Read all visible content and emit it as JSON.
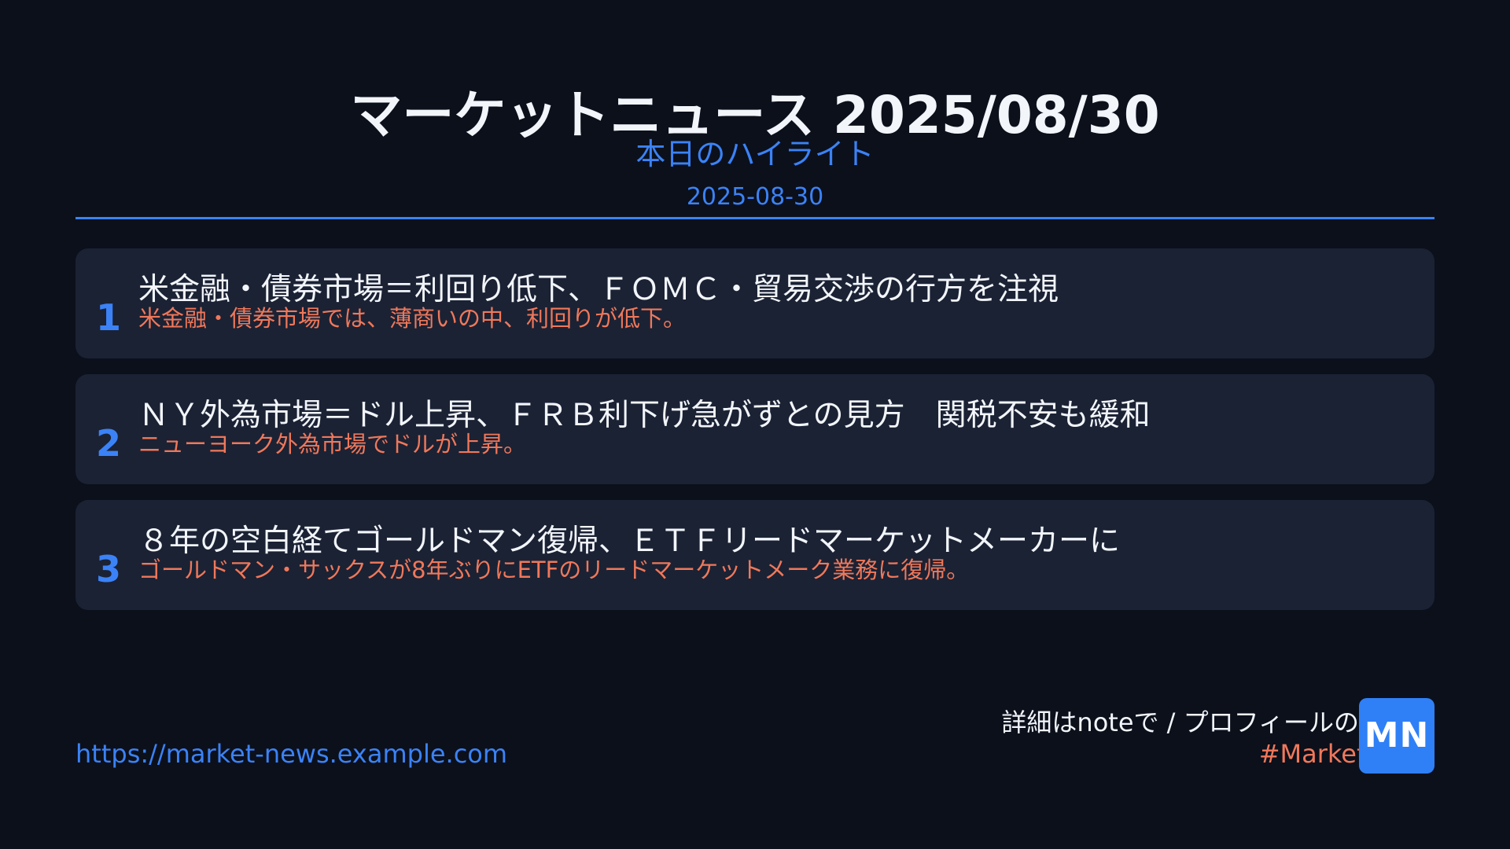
{
  "header": {
    "title": "マーケットニュース 2025/08/30",
    "subtitle": "本日のハイライト",
    "date": "2025-08-30"
  },
  "news": [
    {
      "number": "1",
      "headline": "米金融・債券市場＝利回り低下、ＦＯＭＣ・貿易交渉の行方を注視",
      "summary": "米金融・債券市場では、薄商いの中、利回りが低下。"
    },
    {
      "number": "2",
      "headline": "ＮＹ外為市場＝ドル上昇、ＦＲＢ利下げ急がずとの見方　関税不安も緩和",
      "summary": "ニューヨーク外為市場でドルが上昇。"
    },
    {
      "number": "3",
      "headline": "８年の空白経てゴールドマン復帰、ＥＴＦリードマーケットメーカーに",
      "summary": "ゴールドマン・サックスが8年ぶりにETFのリードマーケットメーク業務に復帰。"
    }
  ],
  "footer": {
    "url": "https://market-news.example.com",
    "note": "詳細はnoteで / プロフィールのリンク",
    "hashtag": "#MarketNews",
    "logo": "MN"
  },
  "colors": {
    "background": "#0b101b",
    "card": "#1b2234",
    "accent": "#3b82f6",
    "highlight": "#f0785a",
    "text": "#f2f5fa"
  }
}
